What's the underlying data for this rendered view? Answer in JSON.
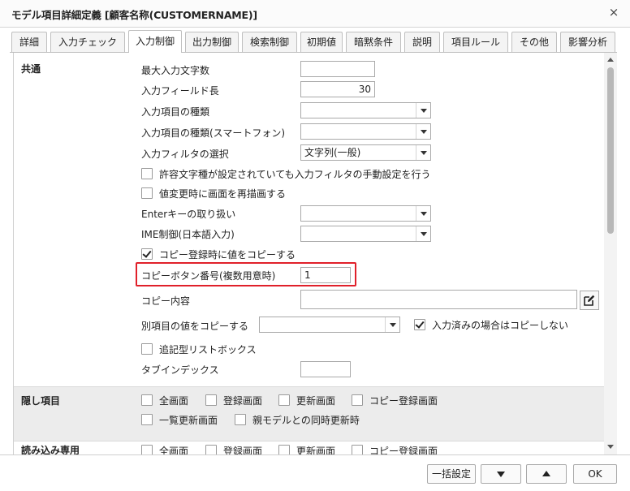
{
  "window": {
    "title": "モデル項目詳細定義 [顧客名称(CUSTOMERNAME)]",
    "close_label": "×"
  },
  "tabs": [
    {
      "label": "詳細",
      "active": false
    },
    {
      "label": "入力チェック",
      "active": false
    },
    {
      "label": "入力制御",
      "active": true
    },
    {
      "label": "出力制御",
      "active": false
    },
    {
      "label": "検索制御",
      "active": false
    },
    {
      "label": "初期値",
      "active": false
    },
    {
      "label": "暗黙条件",
      "active": false
    },
    {
      "label": "説明",
      "active": false
    },
    {
      "label": "項目ルール",
      "active": false
    },
    {
      "label": "その他",
      "active": false
    },
    {
      "label": "影響分析",
      "active": false
    }
  ],
  "common": {
    "section_title": "共通",
    "max_input_chars": {
      "label": "最大入力文字数",
      "value": ""
    },
    "field_length": {
      "label": "入力フィールド長",
      "value": "30"
    },
    "input_type": {
      "label": "入力項目の種類",
      "value": ""
    },
    "input_type_smartphone": {
      "label": "入力項目の種類(スマートフォン)",
      "value": ""
    },
    "input_filter": {
      "label": "入力フィルタの選択",
      "value": "文字列(一般)"
    },
    "manual_filter": {
      "label": "許容文字種が設定されていても入力フィルタの手動設定を行う",
      "checked": false
    },
    "redraw_on_change": {
      "label": "値変更時に画面を再描画する",
      "checked": false
    },
    "enter_key": {
      "label": "Enterキーの取り扱い",
      "value": ""
    },
    "ime_control": {
      "label": "IME制御(日本語入力)",
      "value": ""
    },
    "copy_on_register": {
      "label": "コピー登録時に値をコピーする",
      "checked": true
    },
    "copy_button_no": {
      "label": "コピーボタン番号(複数用意時)",
      "value": "1"
    },
    "copy_content": {
      "label": "コピー内容",
      "value": ""
    },
    "copy_other_item": {
      "label": "別項目の値をコピーする",
      "value": ""
    },
    "skip_if_filled": {
      "label": "入力済みの場合はコピーしない",
      "checked": true
    },
    "append_listbox": {
      "label": "追記型リストボックス",
      "checked": false
    },
    "tab_index": {
      "label": "タブインデックス",
      "value": ""
    }
  },
  "hidden": {
    "section_title": "隠し項目",
    "options": [
      {
        "label": "全画面",
        "checked": false
      },
      {
        "label": "登録画面",
        "checked": false
      },
      {
        "label": "更新画面",
        "checked": false
      },
      {
        "label": "コピー登録画面",
        "checked": false
      },
      {
        "label": "一覧更新画面",
        "checked": false
      },
      {
        "label": "親モデルとの同時更新時",
        "checked": false
      }
    ]
  },
  "readonly": {
    "section_title": "読み込み専用",
    "options": [
      {
        "label": "全画面",
        "checked": false
      },
      {
        "label": "登録画面",
        "checked": false
      },
      {
        "label": "更新画面",
        "checked": false
      },
      {
        "label": "コピー登録画面",
        "checked": false
      }
    ]
  },
  "footer": {
    "bulk_set_label": "一括設定",
    "ok_label": "OK"
  },
  "colors": {
    "highlight": "#e0202a",
    "section_bg": "#ececec"
  },
  "icons": {
    "edit": "pencil-square-icon",
    "down": "triangle-down-icon",
    "up": "triangle-up-icon"
  }
}
